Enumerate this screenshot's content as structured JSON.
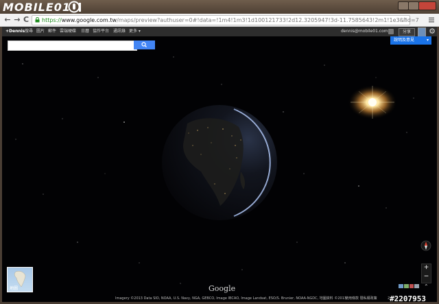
{
  "watermark": {
    "brand": "MOBILE01",
    "id": "#2207953"
  },
  "browser": {
    "nav": {
      "back": "←",
      "forward": "→",
      "reload": "C"
    },
    "url": {
      "scheme": "https://",
      "host": "www.google.com.tw",
      "path": "/maps/preview?authuser=0#!data=!1m4!1m3!1d100121733!2d12.3205947!3d-11.7585643!2m1!1e3&fid=7"
    },
    "star": "☆"
  },
  "gbar": {
    "items": [
      "+Dennis",
      "搜尋",
      "圖片",
      "郵件",
      "雲端硬碟",
      "日曆",
      "協作平台",
      "通訊錄",
      "更多 ▾"
    ],
    "email": "dennis@mobile01.com",
    "share_label": "分享"
  },
  "map": {
    "search_value": "",
    "help_label": "說明及意見",
    "earth_thumb_label": "地圖",
    "google_logo": "Google",
    "copyright": "Imagery ©2013 Data SIO, NOAA, U.S. Navy, NGA, GEBCO, Image IBCAO, Image Landsat, ESO/S. Brunier, NOAA-NGDC, 地圖資料 ©2013",
    "terms": "使用條款  隱私權政策",
    "scale": "2000",
    "zoom": {
      "in": "+",
      "out": "−"
    },
    "expand": "⌃"
  }
}
